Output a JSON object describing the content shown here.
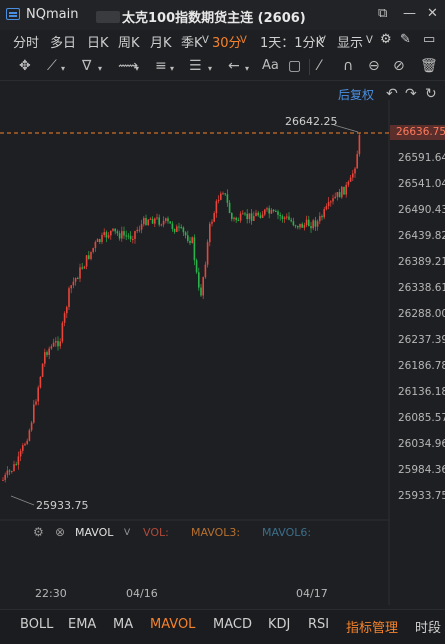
{
  "app": {
    "name": "NQmain",
    "title": "太克100指数期货主连 (2606)"
  },
  "periods": {
    "items": [
      "分时",
      "多日",
      "日K",
      "周K",
      "月K",
      "季K"
    ],
    "active": "30分",
    "multi": "1天：1分K",
    "display": "显示"
  },
  "chart": {
    "restore_label": "后复权",
    "price_ticks": [
      "26591.64",
      "26541.04",
      "26490.43",
      "26439.82",
      "26389.21",
      "26338.61",
      "26288.00",
      "26237.39",
      "26186.78",
      "26136.18",
      "26085.57",
      "26034.96",
      "25984.36",
      "25933.75"
    ],
    "last_price": "26636.75",
    "high_label": "26642.25",
    "low_label": "25933.75",
    "time_ticks": [
      "22:30",
      "04/16",
      "04/17"
    ]
  },
  "indicator": {
    "name": "MAVOL",
    "vol": "VOL:",
    "mavol3": "MAVOL3:",
    "mavol6": "MAVOL6:",
    "colors": {
      "vol": "#b04a3a",
      "mavol3": "#b8702f",
      "mavol6": "#3c6e8a"
    }
  },
  "tabs": {
    "items": [
      "BOLL",
      "EMA",
      "MA",
      "MAVOL",
      "MACD",
      "KDJ",
      "RSI",
      "指标管理",
      "时段"
    ],
    "active": "MAVOL"
  },
  "colors": {
    "up": "#e8463c",
    "down": "#2bb24c",
    "accent": "#f5822b",
    "link": "#4a90e2"
  }
}
